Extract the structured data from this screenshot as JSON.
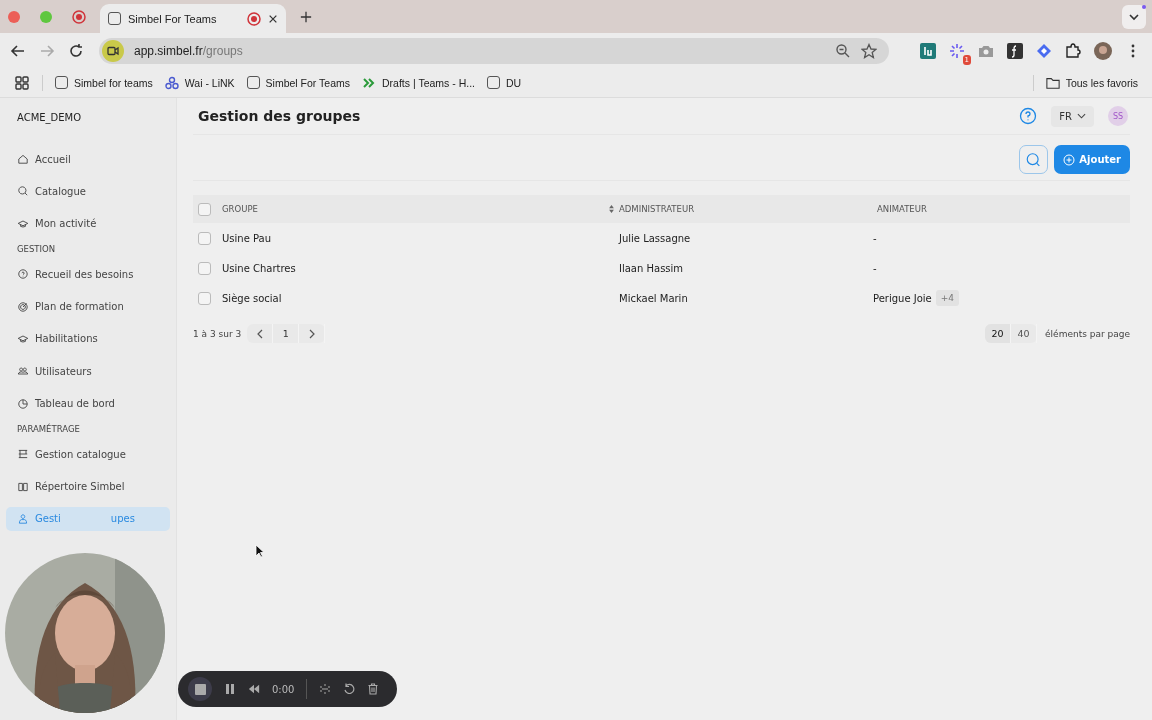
{
  "browser": {
    "tab": {
      "title": "Simbel For Teams",
      "recording": true
    },
    "url_host": "app.simbel.fr",
    "url_path": "/groups",
    "extension_badge": "1",
    "bookmarks": [
      {
        "label": "Simbel for teams",
        "kind": "s"
      },
      {
        "label": "Wai - LiNK",
        "kind": "link"
      },
      {
        "label": "Simbel For Teams",
        "kind": "s"
      },
      {
        "label": "Drafts | Teams - H...",
        "kind": "drafts"
      },
      {
        "label": "DU",
        "kind": "s"
      }
    ],
    "all_bookmarks": "Tous les favoris"
  },
  "sidebar": {
    "org": "ACME_DEMO",
    "entries": [
      {
        "kind": "link",
        "label": "Accueil",
        "selected": false
      },
      {
        "kind": "link",
        "label": "Catalogue",
        "selected": false
      },
      {
        "kind": "link",
        "label": "Mon activité",
        "selected": false
      },
      {
        "kind": "heading",
        "label": "GESTION"
      },
      {
        "kind": "link",
        "label": "Recueil des besoins",
        "selected": false
      },
      {
        "kind": "link",
        "label": "Plan de formation",
        "selected": false
      },
      {
        "kind": "link",
        "label": "Habilitations",
        "selected": false
      },
      {
        "kind": "link",
        "label": "Utilisateurs",
        "selected": false
      },
      {
        "kind": "link",
        "label": "Tableau de bord",
        "selected": false
      },
      {
        "kind": "heading",
        "label": "PARAMÉTRAGE"
      },
      {
        "kind": "link",
        "label": "Gestion catalogue",
        "selected": false
      },
      {
        "kind": "link",
        "label": "Répertoire Simbel",
        "selected": false
      },
      {
        "kind": "link",
        "label_parts": [
          "Gesti",
          "upes"
        ],
        "selected": true
      }
    ]
  },
  "header": {
    "title": "Gestion des groupes",
    "language": "FR",
    "avatar": "SS"
  },
  "toolbar": {
    "add_button": "Ajouter"
  },
  "table": {
    "select_all_checked": false,
    "columns": [
      {
        "label": "GROUPE",
        "sortable": false
      },
      {
        "label": "ADMINISTRATEUR",
        "sortable": true
      },
      {
        "label": "ANIMATEUR",
        "sortable": false
      }
    ],
    "rows": [
      {
        "checked": false,
        "group": "Usine Pau",
        "admin": "Julie Lassagne",
        "animator": "-"
      },
      {
        "checked": false,
        "group": "Usine Chartres",
        "admin": "Ilaan Hassim",
        "animator": "-"
      },
      {
        "checked": false,
        "group": "Siège social",
        "admin": "Mickael Marin",
        "animator": "Perigue Joie",
        "more": "+4"
      }
    ]
  },
  "pagination": {
    "range": "1 à 3 sur 3",
    "page": "1",
    "sizes": [
      {
        "label": "20",
        "selected": true
      },
      {
        "label": "40",
        "selected": false
      }
    ],
    "per_page_label": "éléments par page"
  },
  "recorder": {
    "time": "0:00"
  }
}
